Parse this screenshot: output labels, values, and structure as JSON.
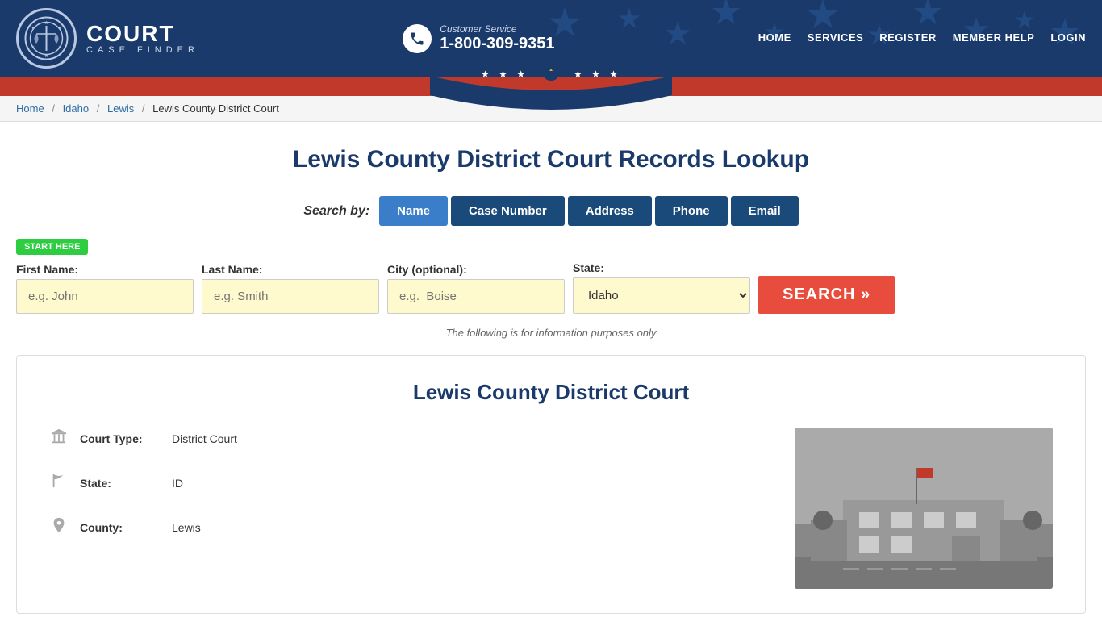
{
  "header": {
    "logo": {
      "court_text": "COURT",
      "finder_text": "CASE FINDER"
    },
    "customer_service": {
      "label": "Customer Service",
      "phone": "1-800-309-9351"
    },
    "nav": [
      {
        "label": "HOME",
        "href": "#"
      },
      {
        "label": "SERVICES",
        "href": "#"
      },
      {
        "label": "REGISTER",
        "href": "#"
      },
      {
        "label": "MEMBER HELP",
        "href": "#"
      },
      {
        "label": "LOGIN",
        "href": "#"
      }
    ]
  },
  "breadcrumb": {
    "items": [
      {
        "label": "Home",
        "href": "#"
      },
      {
        "label": "Idaho",
        "href": "#"
      },
      {
        "label": "Lewis",
        "href": "#"
      },
      {
        "label": "Lewis County District Court",
        "href": null
      }
    ]
  },
  "page": {
    "title": "Lewis County District Court Records Lookup"
  },
  "search": {
    "by_label": "Search by:",
    "tabs": [
      {
        "label": "Name",
        "active": true
      },
      {
        "label": "Case Number",
        "active": false
      },
      {
        "label": "Address",
        "active": false
      },
      {
        "label": "Phone",
        "active": false
      },
      {
        "label": "Email",
        "active": false
      }
    ],
    "start_here": "START HERE",
    "form": {
      "first_name_label": "First Name:",
      "first_name_placeholder": "e.g. John",
      "last_name_label": "Last Name:",
      "last_name_placeholder": "e.g. Smith",
      "city_label": "City (optional):",
      "city_placeholder": "e.g.  Boise",
      "state_label": "State:",
      "state_value": "Idaho",
      "search_button": "SEARCH »"
    },
    "info_text": "The following is for information purposes only"
  },
  "court_card": {
    "title": "Lewis County District Court",
    "details": [
      {
        "icon": "building-icon",
        "label": "Court Type:",
        "value": "District Court"
      },
      {
        "icon": "flag-icon",
        "label": "State:",
        "value": "ID"
      },
      {
        "icon": "map-icon",
        "label": "County:",
        "value": "Lewis"
      }
    ]
  }
}
